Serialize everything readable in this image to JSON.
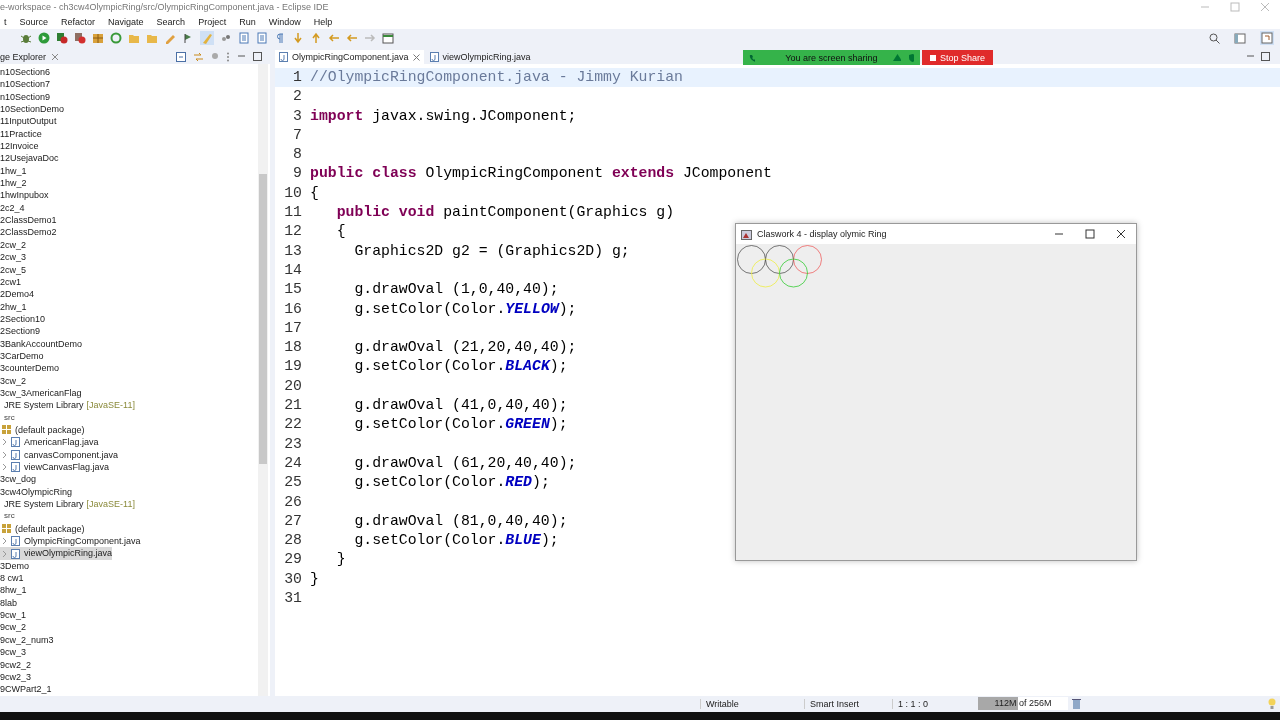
{
  "window": {
    "title": "e-workspace - ch3cw4OlympicRing/src/OlympicRingComponent.java - Eclipse IDE"
  },
  "menu": [
    "t",
    "Source",
    "Refactor",
    "Navigate",
    "Search",
    "Project",
    "Run",
    "Window",
    "Help"
  ],
  "sidebar": {
    "title": "ge Explorer",
    "items": [
      {
        "kind": "project",
        "label": "n10Section6",
        "selected": false
      },
      {
        "kind": "project",
        "label": "n10Section7",
        "selected": false
      },
      {
        "kind": "project",
        "label": "n10Section9",
        "selected": false
      },
      {
        "kind": "project",
        "label": "10SectionDemo",
        "selected": false
      },
      {
        "kind": "project",
        "label": "11InputOutput",
        "selected": false
      },
      {
        "kind": "project",
        "label": "11Practice",
        "selected": false
      },
      {
        "kind": "project",
        "label": "12Invoice",
        "selected": false
      },
      {
        "kind": "project",
        "label": "12UsejavaDoc",
        "selected": false
      },
      {
        "kind": "project",
        "label": "1hw_1",
        "selected": false
      },
      {
        "kind": "project",
        "label": "1hw_2",
        "selected": false
      },
      {
        "kind": "project",
        "label": "1hwInpubox",
        "selected": false
      },
      {
        "kind": "project",
        "label": "2c2_4",
        "selected": false
      },
      {
        "kind": "project",
        "label": "2ClassDemo1",
        "selected": false
      },
      {
        "kind": "project",
        "label": "2ClassDemo2",
        "selected": false
      },
      {
        "kind": "project",
        "label": "2cw_2",
        "selected": false
      },
      {
        "kind": "project",
        "label": "2cw_3",
        "selected": false
      },
      {
        "kind": "project",
        "label": "2cw_5",
        "selected": false
      },
      {
        "kind": "project",
        "label": "2cw1",
        "selected": false
      },
      {
        "kind": "project",
        "label": "2Demo4",
        "selected": false
      },
      {
        "kind": "project",
        "label": "2hw_1",
        "selected": false
      },
      {
        "kind": "project",
        "label": "2Section10",
        "selected": false
      },
      {
        "kind": "project",
        "label": "2Section9",
        "selected": false
      },
      {
        "kind": "project",
        "label": "3BankAccountDemo",
        "selected": false
      },
      {
        "kind": "project",
        "label": "3CarDemo",
        "selected": false
      },
      {
        "kind": "project",
        "label": "3counterDemo",
        "selected": false
      },
      {
        "kind": "project",
        "label": "3cw_2",
        "selected": false
      },
      {
        "kind": "project",
        "label": "3cw_3AmericanFlag",
        "selected": false,
        "children": [
          {
            "kind": "library",
            "label": "JRE System Library",
            "version": "[JavaSE-11]",
            "selected": false
          },
          {
            "kind": "folder",
            "label": "src",
            "selected": false,
            "children": [
              {
                "kind": "package",
                "label": "(default package)",
                "selected": false,
                "children": [
                  {
                    "kind": "file",
                    "label": "AmericanFlag.java",
                    "selected": false
                  },
                  {
                    "kind": "file",
                    "label": "canvasComponent.java",
                    "selected": false
                  },
                  {
                    "kind": "file",
                    "label": "viewCanvasFlag.java",
                    "selected": false
                  }
                ]
              }
            ]
          }
        ]
      },
      {
        "kind": "project",
        "label": "3cw_dog",
        "selected": false
      },
      {
        "kind": "project",
        "label": "3cw4OlympicRing",
        "selected": false,
        "children": [
          {
            "kind": "library",
            "label": "JRE System Library",
            "version": "[JavaSE-11]",
            "selected": false
          },
          {
            "kind": "folder",
            "label": "src",
            "selected": false,
            "children": [
              {
                "kind": "package",
                "label": "(default package)",
                "selected": false,
                "children": [
                  {
                    "kind": "file",
                    "label": "OlympicRingComponent.java",
                    "selected": false
                  },
                  {
                    "kind": "file",
                    "label": "viewOlympicRing.java",
                    "selected": true
                  }
                ]
              }
            ]
          }
        ]
      },
      {
        "kind": "project",
        "label": "3Demo",
        "selected": false
      },
      {
        "kind": "project",
        "label": "8 cw1",
        "selected": false
      },
      {
        "kind": "project",
        "label": "8hw_1",
        "selected": false
      },
      {
        "kind": "project",
        "label": "8lab",
        "selected": false
      },
      {
        "kind": "project",
        "label": "9cw_1",
        "selected": false
      },
      {
        "kind": "project",
        "label": "9cw_2",
        "selected": false
      },
      {
        "kind": "project",
        "label": "9cw_2_num3",
        "selected": false
      },
      {
        "kind": "project",
        "label": "9cw_3",
        "selected": false
      },
      {
        "kind": "project",
        "label": "9cw2_2",
        "selected": false
      },
      {
        "kind": "project",
        "label": "9cw2_3",
        "selected": false
      },
      {
        "kind": "project",
        "label": "9CWPart2_1",
        "selected": false
      }
    ]
  },
  "editor": {
    "tabs": [
      {
        "label": "OlympicRingComponent.java",
        "selected": true
      },
      {
        "label": "viewOlympicRing.java",
        "selected": false
      }
    ],
    "lines": [
      {
        "number": "1",
        "tokens": [
          {
            "kind": "comment",
            "text": "//OlympicRingComponent.java - Jimmy Kurian"
          }
        ]
      },
      {
        "number": "2"
      },
      {
        "number": "3",
        "tokens": [
          {
            "kind": "keyword",
            "text": "import"
          },
          {
            "kind": "plain",
            "text": " javax.swing.JComponent;"
          }
        ]
      },
      {
        "number": "7"
      },
      {
        "number": "8"
      },
      {
        "number": "9",
        "tokens": [
          {
            "kind": "keyword",
            "text": "public class"
          },
          {
            "kind": "plain",
            "text": " OlympicRingComponent "
          },
          {
            "kind": "keyword",
            "text": "extends"
          },
          {
            "kind": "plain",
            "text": " JComponent"
          }
        ]
      },
      {
        "number": "10",
        "tokens": [
          {
            "kind": "plain",
            "text": "{"
          }
        ]
      },
      {
        "number": "11",
        "tokens": [
          {
            "kind": "keyword",
            "text": "   public void"
          },
          {
            "kind": "plain",
            "text": " paintComponent(Graphics g)"
          }
        ]
      },
      {
        "number": "12",
        "tokens": [
          {
            "kind": "plain",
            "text": "   {"
          }
        ]
      },
      {
        "number": "13",
        "tokens": [
          {
            "kind": "plain",
            "text": "     Graphics2D g2 = (Graphics2D) g;"
          }
        ]
      },
      {
        "number": "14"
      },
      {
        "number": "15",
        "tokens": [
          {
            "kind": "plain",
            "text": "     g.drawOval (1,0,40,40);"
          }
        ]
      },
      {
        "number": "16",
        "tokens": [
          {
            "kind": "plain",
            "text": "     g.setColor(Color."
          },
          {
            "kind": "constant",
            "text": "YELLOW"
          },
          {
            "kind": "plain",
            "text": ");"
          }
        ]
      },
      {
        "number": "17"
      },
      {
        "number": "18",
        "tokens": [
          {
            "kind": "plain",
            "text": "     g.drawOval (21,20,40,40);"
          }
        ]
      },
      {
        "number": "19",
        "tokens": [
          {
            "kind": "plain",
            "text": "     g.setColor(Color."
          },
          {
            "kind": "constant",
            "text": "BLACK"
          },
          {
            "kind": "plain",
            "text": ");"
          }
        ]
      },
      {
        "number": "20"
      },
      {
        "number": "21",
        "tokens": [
          {
            "kind": "plain",
            "text": "     g.drawOval (41,0,40,40);"
          }
        ]
      },
      {
        "number": "22",
        "tokens": [
          {
            "kind": "plain",
            "text": "     g.setColor(Color."
          },
          {
            "kind": "constant",
            "text": "GREEN"
          },
          {
            "kind": "plain",
            "text": ");"
          }
        ]
      },
      {
        "number": "23"
      },
      {
        "number": "24",
        "tokens": [
          {
            "kind": "plain",
            "text": "     g.drawOval (61,20,40,40);"
          }
        ]
      },
      {
        "number": "25",
        "tokens": [
          {
            "kind": "plain",
            "text": "     g.setColor(Color."
          },
          {
            "kind": "constant",
            "text": "RED"
          },
          {
            "kind": "plain",
            "text": ");"
          }
        ]
      },
      {
        "number": "26"
      },
      {
        "number": "27",
        "tokens": [
          {
            "kind": "plain",
            "text": "     g.drawOval (81,0,40,40);"
          }
        ]
      },
      {
        "number": "28",
        "tokens": [
          {
            "kind": "plain",
            "text": "     g.setColor(Color."
          },
          {
            "kind": "constant",
            "text": "BLUE"
          },
          {
            "kind": "plain",
            "text": ");"
          }
        ]
      },
      {
        "number": "29",
        "tokens": [
          {
            "kind": "plain",
            "text": "   }"
          }
        ]
      },
      {
        "number": "30",
        "tokens": [
          {
            "kind": "plain",
            "text": "}"
          }
        ]
      },
      {
        "number": "31"
      }
    ]
  },
  "app_window": {
    "title": "Claswork 4 - display olymic Ring"
  },
  "sharing_banner": {
    "message": "You are screen sharing",
    "button": "Stop Share"
  },
  "status_bar": {
    "mode": "Writable",
    "insert": "Smart Insert",
    "position": "1 : 1 : 0",
    "heap": {
      "used": "112M",
      "of": "of 256M",
      "level": 0.44
    }
  }
}
